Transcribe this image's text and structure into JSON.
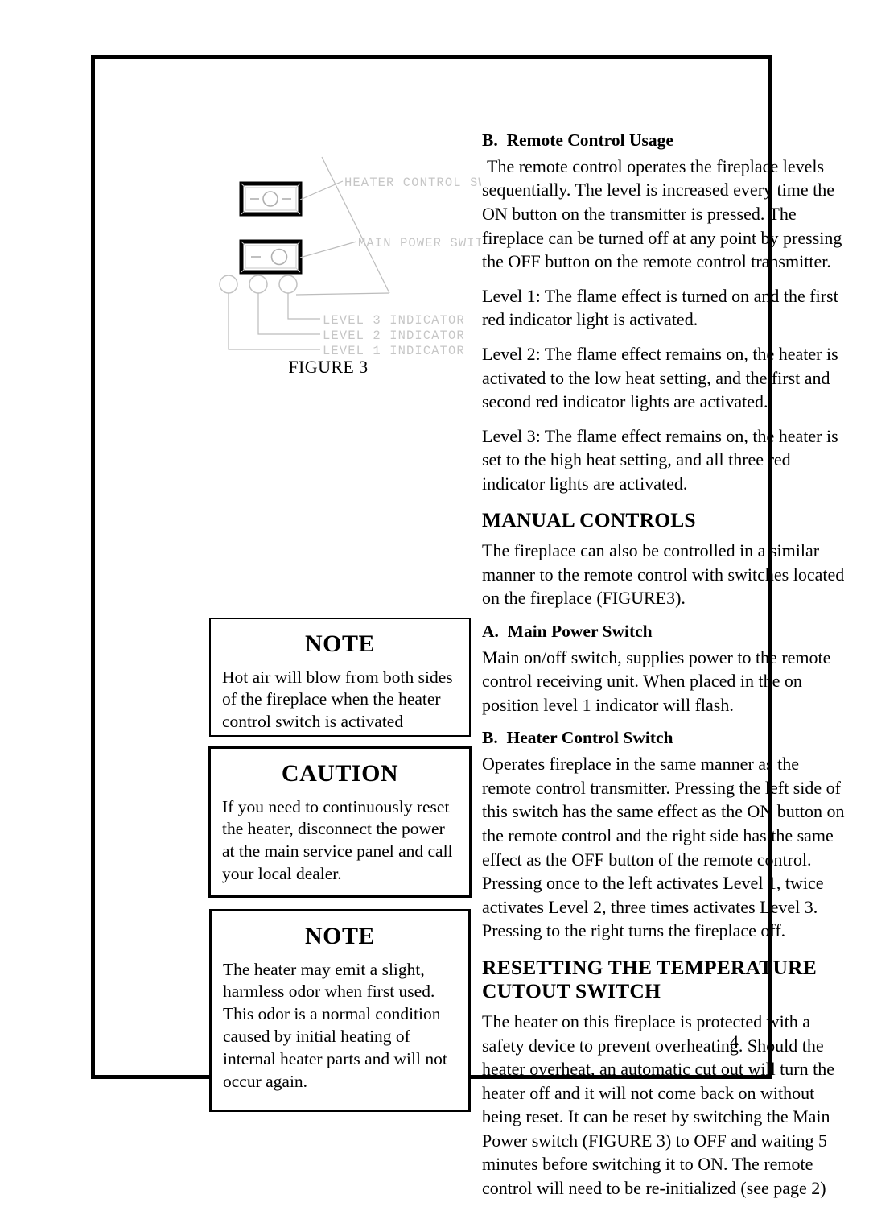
{
  "page": {
    "number": "4"
  },
  "figure": {
    "caption": "FIGURE 3",
    "labels": {
      "heater_control_switch": "HEATER CONTROL SWITCH",
      "main_power_switch": "MAIN POWER SWITCH",
      "level_3_indicator": "LEVEL 3 INDICATOR",
      "level_2_indicator": "LEVEL 2 INDICATOR",
      "level_1_indicator": "LEVEL 1 INDICATOR"
    }
  },
  "callouts": [
    {
      "title": "NOTE",
      "body": "Hot air will blow from both sides of the fireplace when the heater control switch is activated"
    },
    {
      "title": "CAUTION",
      "body": "If you need to continuously reset the heater, disconnect the power at the main service panel and call your local dealer."
    },
    {
      "title": "NOTE",
      "body": "The heater may emit a slight, harmless odor when first used. This odor is a normal condition caused by initial heating of internal heater parts and will not occur again."
    }
  ],
  "content": {
    "remote_usage_heading_letter": "B.",
    "remote_usage_heading_text": "Remote Control Usage",
    "remote_usage_paragraph": "The remote control operates the fireplace levels sequentially.  The level is increased every time the ON button on the transmitter is pressed.  The fireplace can be turned off at any point by pressing the OFF button on the remote control transmitter.",
    "level_1": "Level 1:  The flame effect is turned on and the first red indicator light is activated.",
    "level_2": "Level 2:  The flame effect remains on, the heater is activated to the low heat setting, and the first and second red indicator lights are activated.",
    "level_3": "Level 3:  The flame effect remains on, the heater is set to the high heat setting, and all three red indicator lights are activated.",
    "manual_controls_heading": "MANUAL CONTROLS",
    "manual_controls_paragraph": "The fireplace can also be controlled in a similar manner to the remote control with switches located on the fireplace (FIGURE3).",
    "main_power_heading_letter": "A.",
    "main_power_heading_text": "Main Power Switch",
    "main_power_paragraph": "Main on/off switch, supplies power to the remote control receiving unit.  When placed in the on position level 1 indicator will flash.",
    "heater_control_heading_letter": "B.",
    "heater_control_heading_text": "Heater Control Switch",
    "heater_control_paragraph": "Operates fireplace in the same manner as the remote control transmitter.  Pressing the left side of this switch has the same effect as the ON button on the remote control and the right side has the same effect as the OFF button of the remote control.  Pressing once to the left activates Level 1, twice activates Level 2, three times activates Level 3.  Pressing to the right turns the fireplace off.",
    "resetting_heading": "RESETTING THE TEMPERATURE CUTOUT SWITCH",
    "resetting_paragraph": "The heater on this fireplace is protected with a safety device to prevent overheating.  Should the heater overheat, an automatic cut out will turn the heater off and it will not come back on without being reset.  It can be reset by switching the Main Power switch (FIGURE 3) to OFF and waiting 5 minutes before switching it to ON.  The remote control will need to be re-initialized (see page 2)"
  },
  "colors": {
    "ink": "#000000",
    "figure_line": "#b9b9b9",
    "figure_label": "#c9c9c9",
    "page_background": "#ffffff"
  }
}
